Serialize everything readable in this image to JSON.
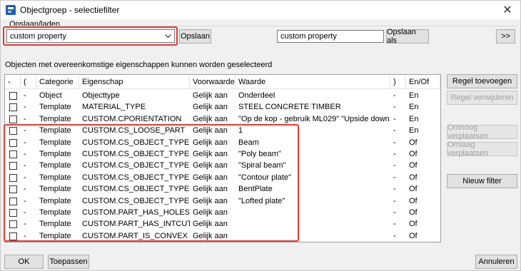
{
  "window": {
    "title": "Objectgroep - selectiefilter",
    "close_glyph": "✕"
  },
  "save_load": {
    "group_label": "Opslaan/laden",
    "combo_value": "custom property",
    "save_button": "Opslaan",
    "save_as_field_value": "custom property",
    "save_as_button": "Opslaan als",
    "expand_button": ">>"
  },
  "info_text": "Objecten met overeenkomstige eigenschappen kunnen worden geselecteerd",
  "table": {
    "headers": [
      "-",
      "(",
      "Categorie",
      "Eigenschap",
      "Voorwaarde",
      "Waarde",
      ")",
      "En/Of"
    ],
    "rows": [
      {
        "minus": "-",
        "open": "",
        "category": "Object",
        "property": "Objecttype",
        "condition": "Gelijk aan",
        "value": "Onderdeel",
        "close": "-",
        "andor": "En"
      },
      {
        "minus": "-",
        "open": "",
        "category": "Template",
        "property": "MATERIAL_TYPE",
        "condition": "Gelijk aan",
        "value": "STEEL CONCRETE TIMBER",
        "close": "-",
        "andor": "En"
      },
      {
        "minus": "-",
        "open": "",
        "category": "Template",
        "property": "CUSTOM.CPORIENTATION",
        "condition": "Gelijk aan",
        "value": "\"Op de kop - gebruik ML029\" \"Upside down...",
        "close": "-",
        "andor": "En"
      },
      {
        "minus": "-",
        "open": "",
        "category": "Template",
        "property": "CUSTOM.CS_LOOSE_PART",
        "condition": "Gelijk aan",
        "value": "1",
        "close": "-",
        "andor": "En"
      },
      {
        "minus": "-",
        "open": "",
        "category": "Template",
        "property": "CUSTOM.CS_OBJECT_TYPE",
        "condition": "Gelijk aan",
        "value": "Beam",
        "close": "-",
        "andor": "Of"
      },
      {
        "minus": "-",
        "open": "",
        "category": "Template",
        "property": "CUSTOM.CS_OBJECT_TYPE",
        "condition": "Gelijk aan",
        "value": "\"Poly beam\"",
        "close": "-",
        "andor": "Of"
      },
      {
        "minus": "-",
        "open": "",
        "category": "Template",
        "property": "CUSTOM.CS_OBJECT_TYPE",
        "condition": "Gelijk aan",
        "value": "\"Spiral beam\"",
        "close": "-",
        "andor": "Of"
      },
      {
        "minus": "-",
        "open": "",
        "category": "Template",
        "property": "CUSTOM.CS_OBJECT_TYPE",
        "condition": "Gelijk aan",
        "value": "\"Contour plate\"",
        "close": "-",
        "andor": "Of"
      },
      {
        "minus": "-",
        "open": "",
        "category": "Template",
        "property": "CUSTOM.CS_OBJECT_TYPE",
        "condition": "Gelijk aan",
        "value": "BentPlate",
        "close": "-",
        "andor": "Of"
      },
      {
        "minus": "-",
        "open": "",
        "category": "Template",
        "property": "CUSTOM.CS_OBJECT_TYPE",
        "condition": "Gelijk aan",
        "value": "\"Lofted plate\"",
        "close": "-",
        "andor": "Of"
      },
      {
        "minus": "-",
        "open": "",
        "category": "Template",
        "property": "CUSTOM.PART_HAS_HOLES",
        "condition": "Gelijk aan",
        "value": "",
        "close": "-",
        "andor": "Of"
      },
      {
        "minus": "-",
        "open": "",
        "category": "Template",
        "property": "CUSTOM.PART_HAS_INTCUTS",
        "condition": "Gelijk aan",
        "value": "",
        "close": "-",
        "andor": "Of"
      },
      {
        "minus": "-",
        "open": "",
        "category": "Template",
        "property": "CUSTOM.PART_IS_CONVEX",
        "condition": "Gelijk aan",
        "value": "",
        "close": "-",
        "andor": "Of"
      }
    ]
  },
  "side_buttons": {
    "add_row": "Regel toevoegen",
    "remove_row": "Regel verwijderen",
    "move_up": "Omhoog verplaatsen",
    "move_down": "Omlaag verplaatsen",
    "new_filter": "Nieuw filter"
  },
  "bottom_buttons": {
    "ok": "OK",
    "apply": "Toepassen",
    "cancel": "Annuleren"
  },
  "colors": {
    "highlight_red": "#e53935",
    "disabled_text": "#a0a0a0"
  }
}
